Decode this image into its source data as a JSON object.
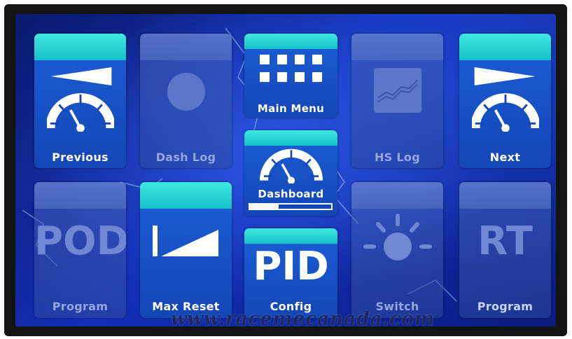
{
  "tiles": {
    "previous": {
      "label": "Previous"
    },
    "dash_log": {
      "label": "Dash Log"
    },
    "main_menu": {
      "label": "Main Menu"
    },
    "hs_log": {
      "label": "HS Log"
    },
    "next": {
      "label": "Next"
    },
    "dashboard": {
      "label": "Dashboard",
      "progress": 0.35
    },
    "program_pod": {
      "label": "Program",
      "big_text": "POD"
    },
    "max_reset": {
      "label": "Max Reset"
    },
    "config": {
      "label": "Config",
      "big_text": "PID"
    },
    "switch": {
      "label": "Switch"
    },
    "program_rt": {
      "label": "Program",
      "big_text": "RT"
    }
  },
  "footer": {
    "url": "www.racemecanada.com"
  },
  "colors": {
    "tile_cap": "#14c2c8",
    "tile_active": "#1446b5",
    "screen_bg": "#1330b8"
  }
}
